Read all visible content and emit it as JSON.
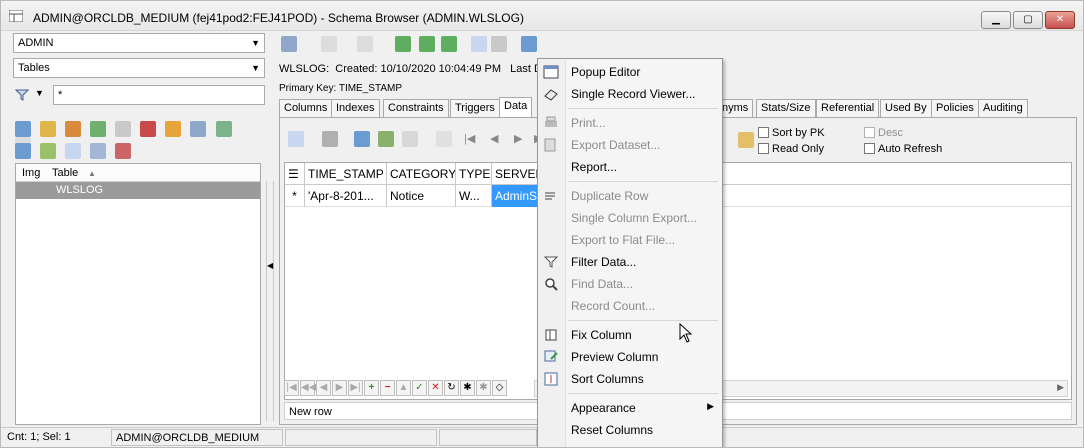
{
  "window": {
    "title": "ADMIN@ORCLDB_MEDIUM (fej41pod2:FEJ41POD) - Schema Browser (ADMIN.WLSLOG)",
    "buttons": [
      "minimize",
      "maximize",
      "close"
    ]
  },
  "left": {
    "schema_value": "ADMIN",
    "object_type_value": "Tables",
    "filter_value": "*",
    "list_headers": [
      "Img",
      "Table"
    ],
    "list_items": [
      "WLSLOG"
    ]
  },
  "right": {
    "info_label": "WLSLOG:",
    "created_label": "Created:",
    "created_value": "10/10/2020 10:04:49 PM",
    "last_ddl_label": "Last D",
    "primary_key_label": "Primary Key:",
    "primary_key_value": "TIME_STAMP",
    "tabs": [
      "Columns",
      "Indexes",
      "Constraints",
      "Triggers",
      "Data",
      "nyms",
      "Stats/Size",
      "Referential",
      "Used By",
      "Policies",
      "Auditing"
    ],
    "active_tab": "Data",
    "options": {
      "sort_by_pk": "Sort by PK",
      "read_only": "Read Only",
      "desc": "Desc",
      "auto_refresh": "Auto Refresh"
    },
    "grid": {
      "headers": [
        "TIME_STAMP",
        "CATEGORY",
        "TYPE",
        "SERVER"
      ],
      "row_marker": "*",
      "row": [
        "'Apr-8-201...",
        "Notice",
        "W...",
        "AdminS"
      ]
    },
    "row_status": "New row"
  },
  "menu": {
    "items": [
      {
        "label": "Popup Editor",
        "disabled": false,
        "icon": "popup-editor-icon"
      },
      {
        "label": "Single Record Viewer...",
        "disabled": false,
        "icon": "record-viewer-icon"
      },
      {
        "label": "Print...",
        "disabled": true,
        "icon": "printer-icon"
      },
      {
        "label": "Export Dataset...",
        "disabled": true,
        "icon": "export-icon"
      },
      {
        "label": "Report...",
        "disabled": false,
        "icon": ""
      },
      {
        "label": "Duplicate Row",
        "disabled": true,
        "icon": "duplicate-icon"
      },
      {
        "label": "Single Column Export...",
        "disabled": true,
        "icon": ""
      },
      {
        "label": "Export to Flat File...",
        "disabled": true,
        "icon": ""
      },
      {
        "label": "Filter Data...",
        "disabled": false,
        "icon": "funnel-icon"
      },
      {
        "label": "Find Data...",
        "disabled": true,
        "icon": "magnifier-icon"
      },
      {
        "label": "Record Count...",
        "disabled": true,
        "icon": ""
      },
      {
        "label": "Fix Column",
        "disabled": false,
        "icon": "fix-column-icon"
      },
      {
        "label": "Preview Column",
        "disabled": false,
        "icon": "preview-column-icon"
      },
      {
        "label": "Sort Columns",
        "disabled": false,
        "icon": "sort-columns-icon"
      },
      {
        "label": "Appearance",
        "disabled": false,
        "icon": "",
        "submenu": true
      },
      {
        "label": "Reset Columns",
        "disabled": false,
        "icon": ""
      }
    ]
  },
  "statusbar": {
    "count": "Cnt: 1; Sel: 1",
    "connection": "ADMIN@ORCLDB_MEDIUM"
  },
  "colors": {
    "selection": "#3399ff",
    "list_selection": "#9a9a9a",
    "disabled_text": "#8b8b8b"
  }
}
